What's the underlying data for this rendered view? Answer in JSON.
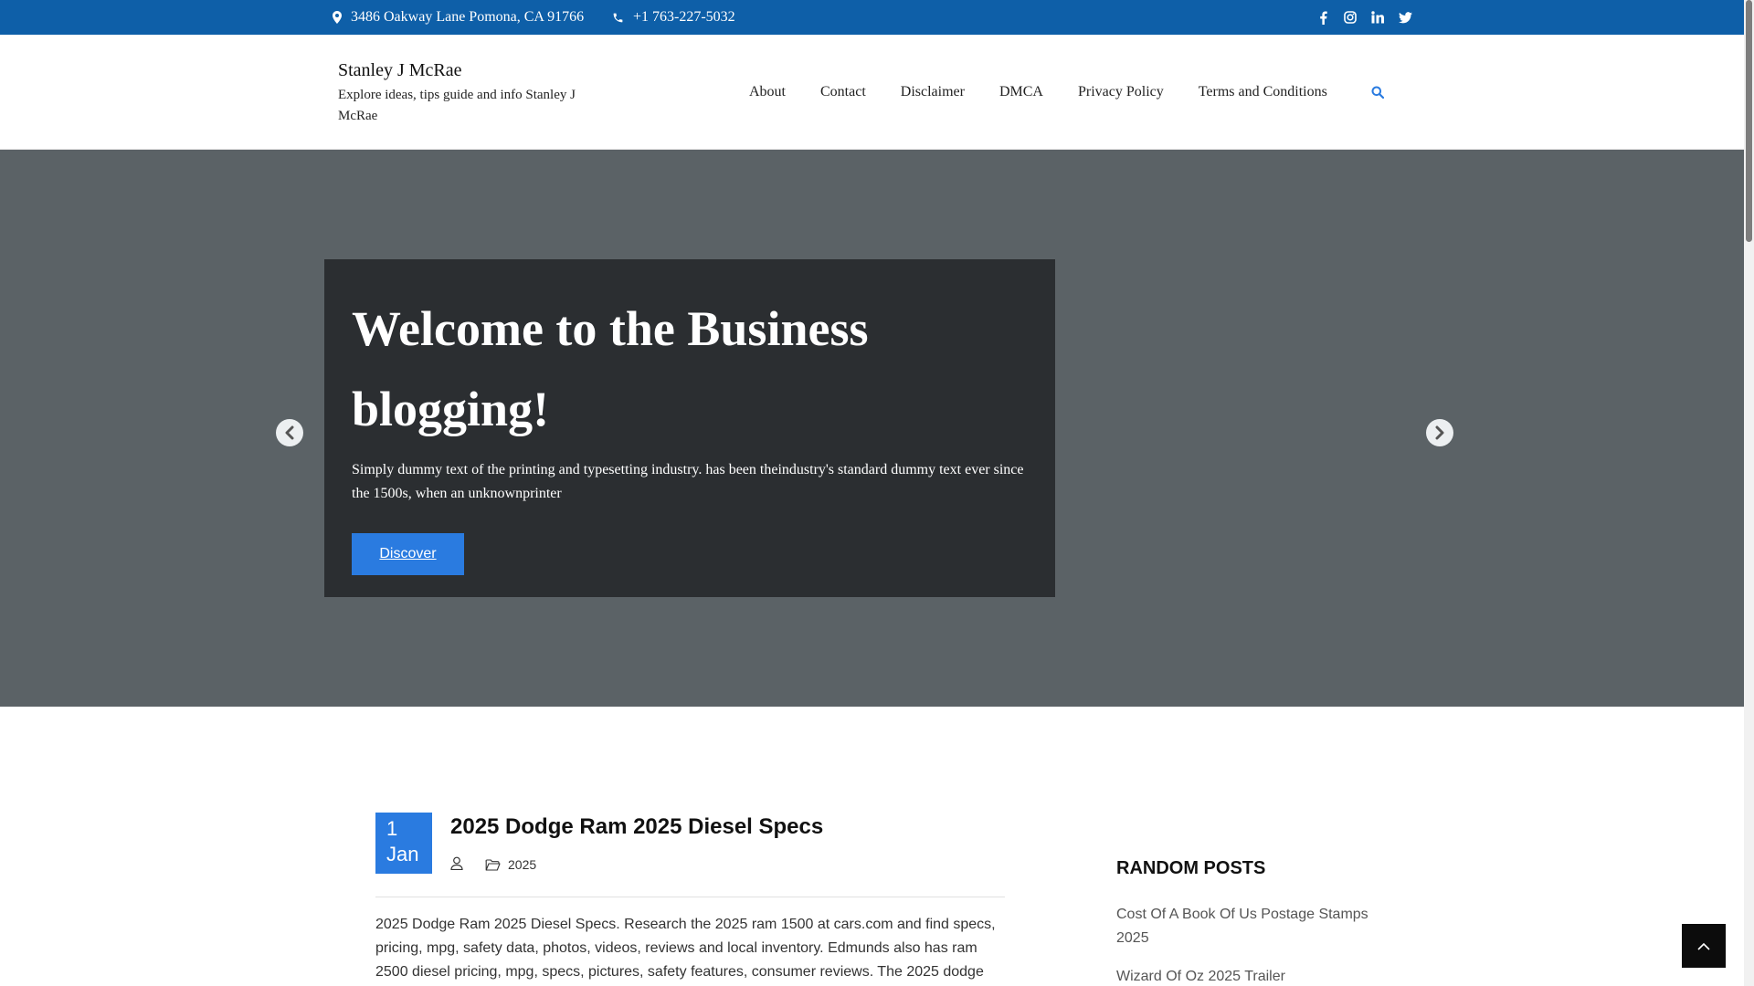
{
  "topbar": {
    "address": "3486 Oakway Lane Pomona, CA 91766",
    "phone": "+1 763-227-5032",
    "social": [
      "facebook-icon",
      "instagram-icon",
      "linkedin-icon",
      "twitter-icon"
    ],
    "bg_color": "#0e5fa8"
  },
  "header": {
    "site_title": "Stanley J McRae",
    "tagline": "Explore ideas, tips guide and info Stanley J McRae",
    "nav": [
      "About",
      "Contact",
      "Disclaimer",
      "DMCA",
      "Privacy Policy",
      "Terms and Conditions"
    ],
    "search_icon": "search-icon"
  },
  "hero": {
    "title": "Welcome to the Business blogging!",
    "text": "Simply dummy text of the printing and typesetting industry. has been theindustry's standard dummy text ever since the 1500s, when an unknownprinter",
    "button": "Discover",
    "accent": "#2a7be0"
  },
  "post": {
    "day": "1",
    "month": "Jan",
    "title": "2025 Dodge Ram 2025 Diesel Specs",
    "category": "2025",
    "excerpt": "2025 Dodge Ram 2025 Diesel Specs. Research the 2025 ram 1500 at cars.com and find specs, pricing, mpg, safety data, photos, videos, reviews and local inventory. Edmunds also has ram 2500 diesel pricing, mpg, specs, pictures, safety features, consumer reviews. The 2025 dodge"
  },
  "sidebar": {
    "heading": "RANDOM POSTS",
    "items": [
      "Cost Of A Book Of Us Postage Stamps 2025",
      "Wizard Of Oz 2025 Trailer"
    ]
  }
}
